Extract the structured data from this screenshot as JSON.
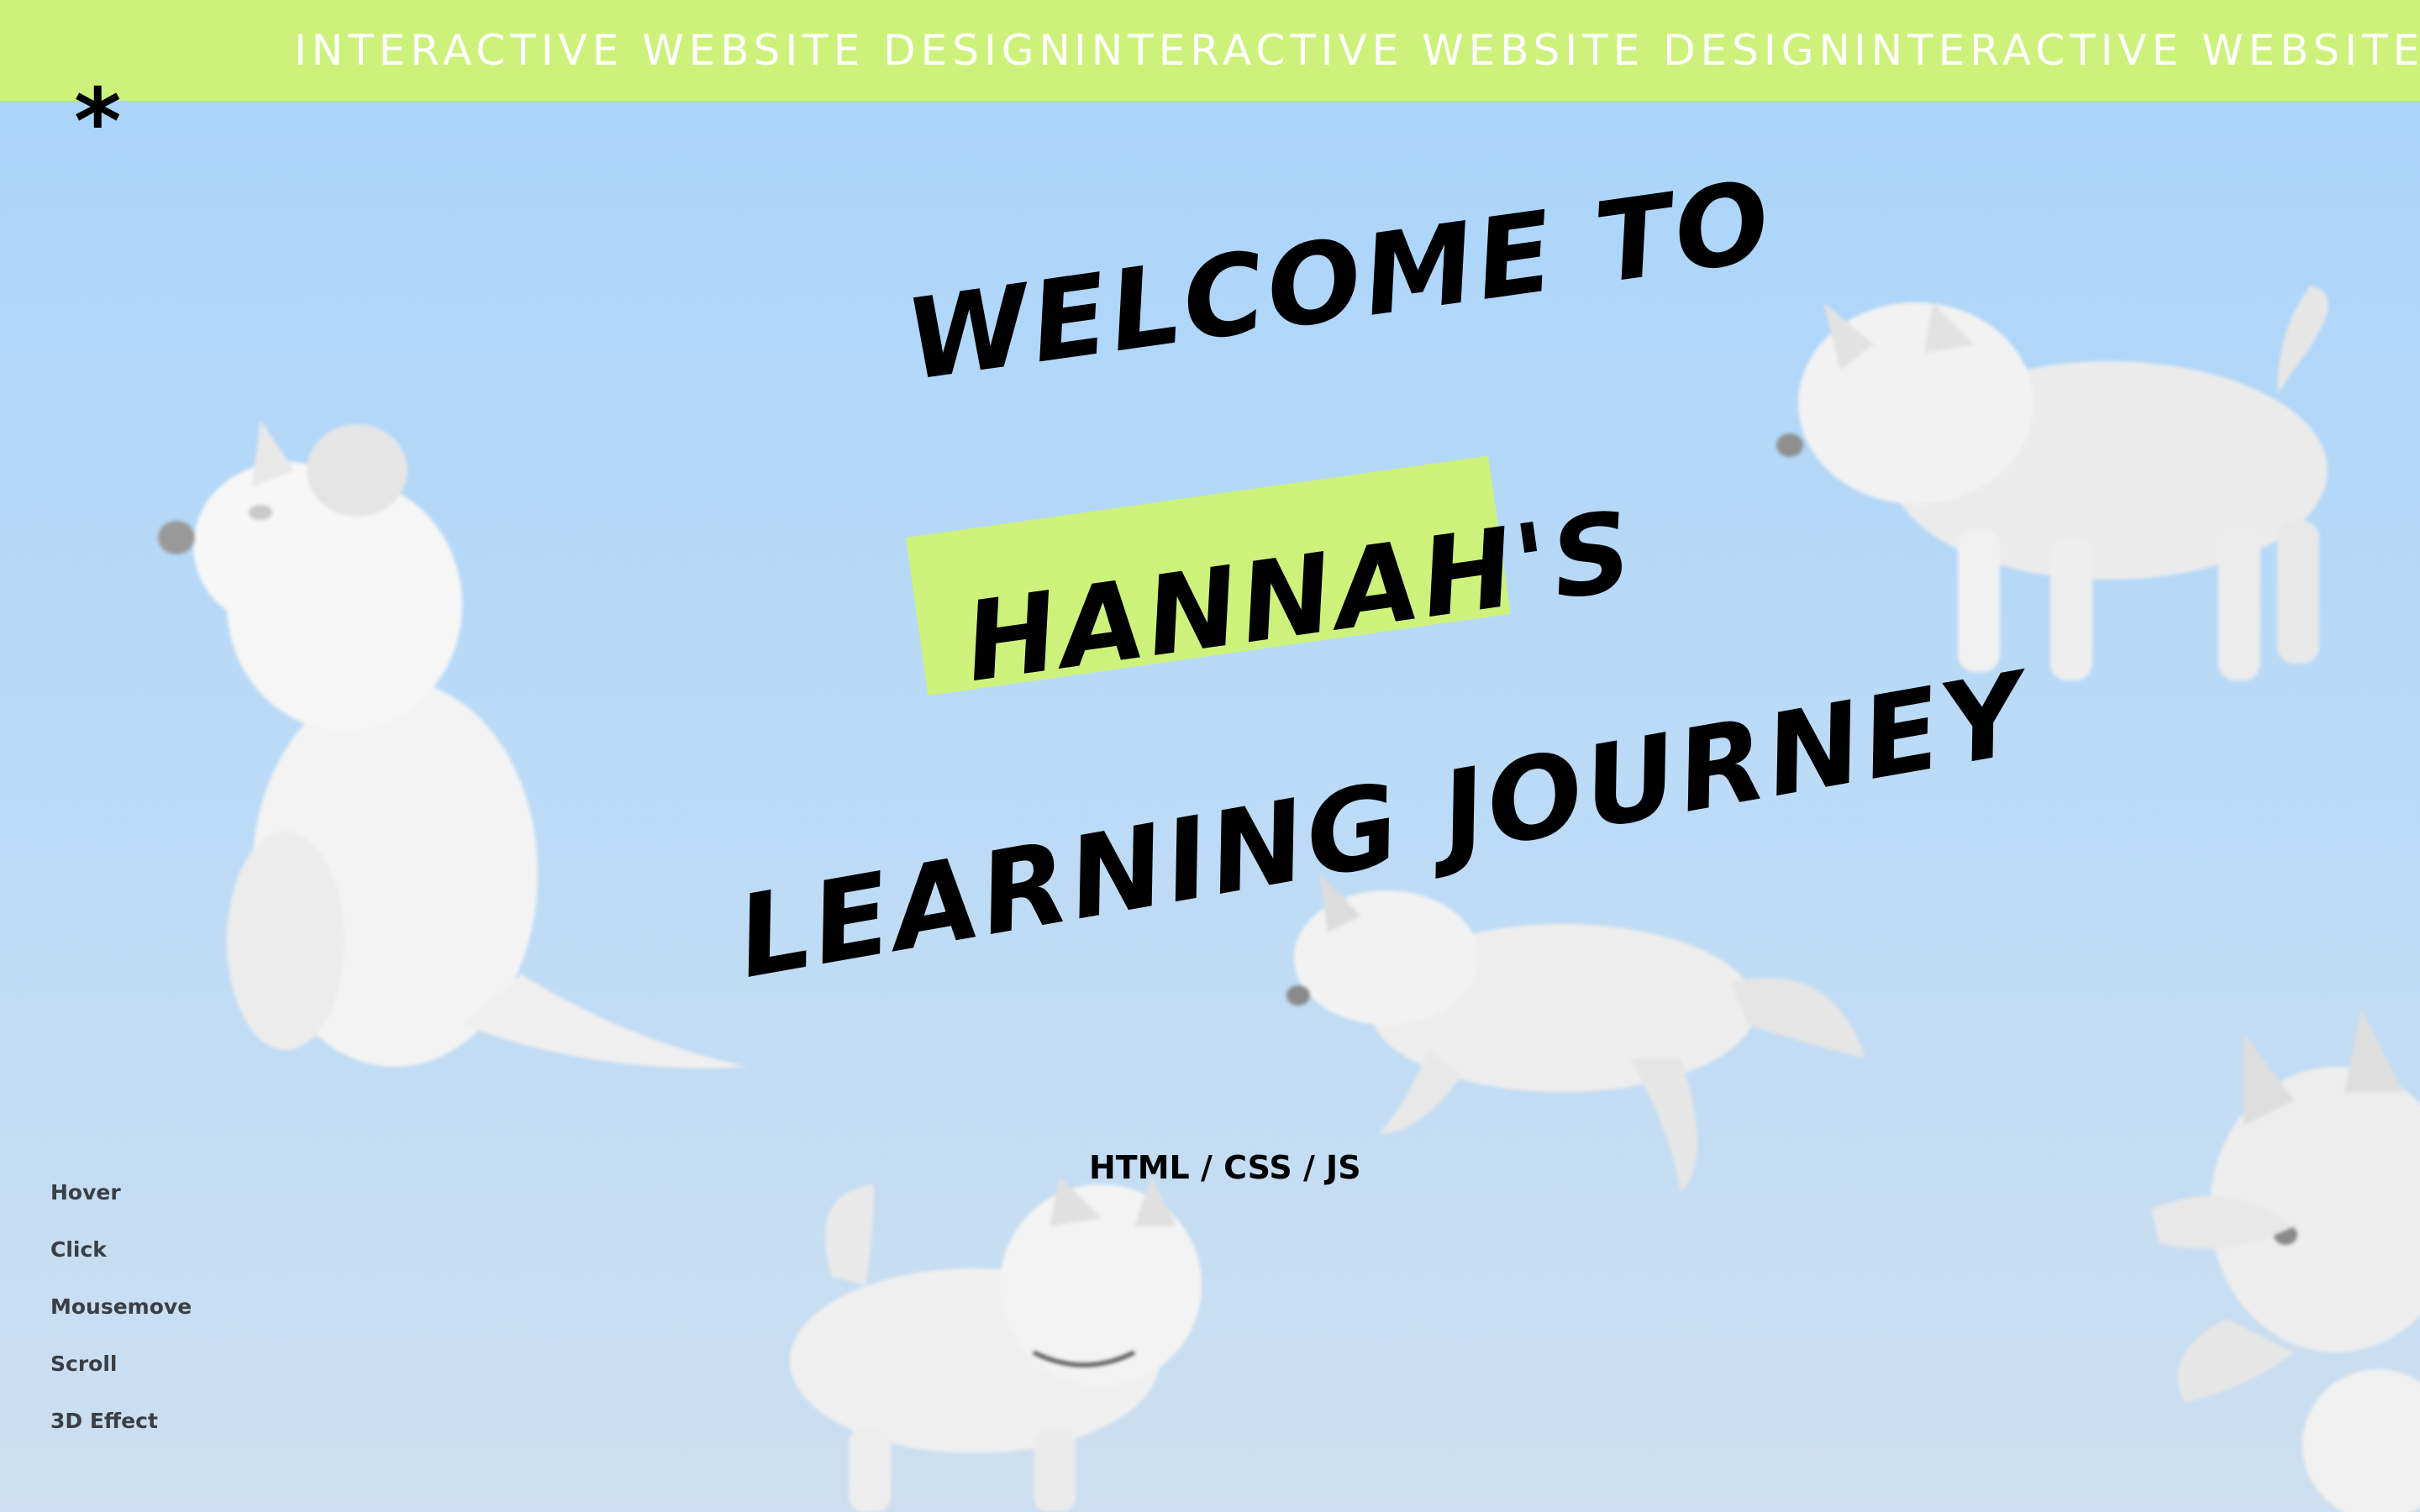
{
  "marquee": {
    "items": [
      "INTERACTIVE WEBSITE DESIGN",
      "INTERACTIVE WEBSITE DESIGN",
      "INTERACTIVE WEBSITE DESIGN"
    ]
  },
  "logo": {
    "symbol": "*"
  },
  "hero": {
    "line1": "WELCOME TO",
    "line2": "HANNAH'S",
    "line3": "LEARNING JOURNEY",
    "subtitle": "HTML / CSS / JS"
  },
  "nav": {
    "items": [
      "Hover",
      "Click",
      "Mousemove",
      "Scroll",
      "3D Effect"
    ]
  },
  "colors": {
    "accent": "#cdf27c",
    "background_top": "#a8d3fb",
    "background_bottom": "#cddff0",
    "text": "#000000",
    "nav_text": "#3a3f46"
  },
  "icons": {
    "logo": "asterisk-icon"
  }
}
